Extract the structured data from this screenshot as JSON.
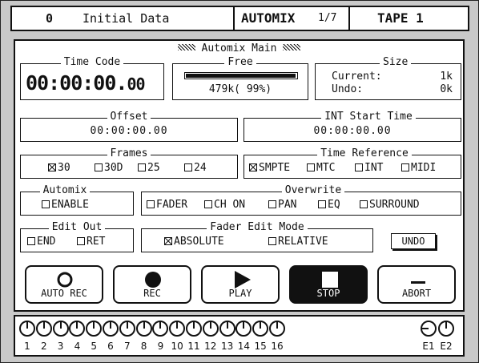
{
  "header": {
    "scene_number": "0",
    "scene_name": "Initial Data",
    "page_title": "AUTOMIX",
    "page_index": "1/7",
    "tape_label": "TAPE 1"
  },
  "panel_title": "Automix Main",
  "time_code": {
    "label": "Time Code",
    "value_main": "00:00:00.",
    "value_frames": "00"
  },
  "free": {
    "label": "Free",
    "value": "479k( 99%)",
    "fill_fraction": 0.99
  },
  "size": {
    "label": "Size",
    "current_label": "Current:",
    "current_value": "1k",
    "undo_label": "Undo:",
    "undo_value": "0k"
  },
  "offset": {
    "label": "Offset",
    "value": "00:00:00.00"
  },
  "int_start_time": {
    "label": "INT Start Time",
    "value": "00:00:00.00"
  },
  "frames": {
    "label": "Frames",
    "options": [
      "30",
      "30D",
      "25",
      "24"
    ],
    "selected": "30"
  },
  "time_reference": {
    "label": "Time Reference",
    "options": [
      "SMPTE",
      "MTC",
      "INT",
      "MIDI"
    ],
    "selected": "SMPTE"
  },
  "automix": {
    "label": "Automix",
    "enable_label": "ENABLE"
  },
  "overwrite": {
    "label": "Overwrite",
    "options": [
      "FADER",
      "CH ON",
      "PAN",
      "EQ",
      "SURROUND"
    ]
  },
  "edit_out": {
    "label": "Edit Out",
    "options": [
      "END",
      "RET"
    ]
  },
  "fader_edit_mode": {
    "label": "Fader Edit Mode",
    "options": [
      "ABSOLUTE",
      "RELATIVE"
    ],
    "selected": "ABSOLUTE"
  },
  "undo_label": "UNDO",
  "transport": {
    "auto_rec": "AUTO REC",
    "rec": "REC",
    "play": "PLAY",
    "stop": "STOP",
    "abort": "ABORT"
  },
  "knobs": [
    "1",
    "2",
    "3",
    "4",
    "5",
    "6",
    "7",
    "8",
    "9",
    "10",
    "11",
    "12",
    "13",
    "14",
    "15",
    "16",
    "E1",
    "E2"
  ]
}
